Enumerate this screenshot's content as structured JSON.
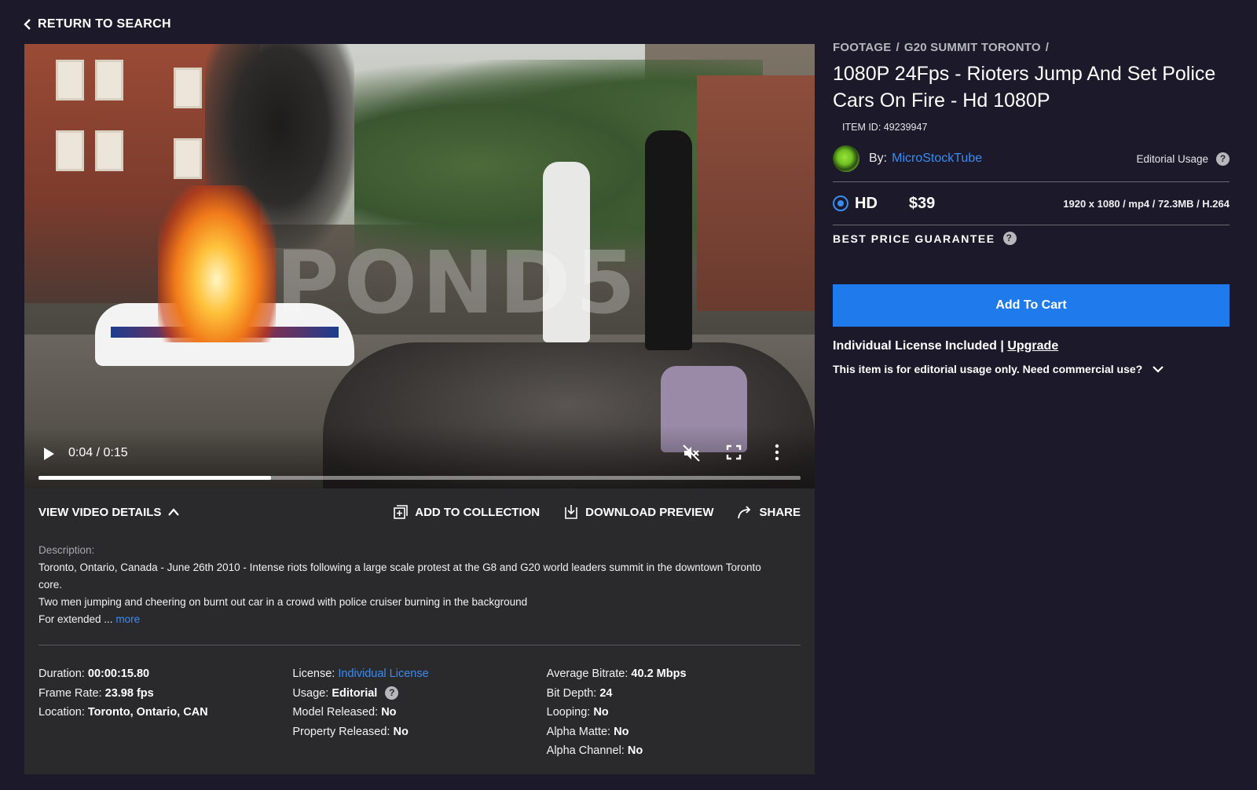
{
  "nav": {
    "back_label": "RETURN TO SEARCH"
  },
  "player": {
    "watermark": "POND5",
    "time_display": "0:04 / 0:15",
    "progress_fraction": 0.305
  },
  "details_bar": {
    "view_details": "VIEW VIDEO DETAILS",
    "add_to_collection": "ADD TO COLLECTION",
    "download_preview": "DOWNLOAD PREVIEW",
    "share": "SHARE"
  },
  "description": {
    "label": "Description:",
    "line1": "Toronto, Ontario, Canada - June 26th 2010 - Intense riots following a large scale protest at the G8 and G20 world leaders summit in the downtown Toronto core.",
    "line2": "Two men jumping and cheering on burnt out car in a crowd with police cruiser burning in the background",
    "line3": "For extended ...",
    "more": "more"
  },
  "meta": {
    "col1": [
      {
        "label": "Duration:",
        "value": "00:00:15.80"
      },
      {
        "label": "Frame Rate:",
        "value": "23.98 fps"
      },
      {
        "label": "Location:",
        "value": "Toronto, Ontario, CAN"
      }
    ],
    "col2": [
      {
        "label": "License:",
        "value": "Individual License"
      },
      {
        "label": "Usage:",
        "value": "Editorial"
      },
      {
        "label": "Model Released:",
        "value": "No"
      },
      {
        "label": "Property Released:",
        "value": "No"
      }
    ],
    "col3": [
      {
        "label": "Average Bitrate:",
        "value": "40.2 Mbps"
      },
      {
        "label": "Bit Depth:",
        "value": "24"
      },
      {
        "label": "Looping:",
        "value": "No"
      },
      {
        "label": "Alpha Matte:",
        "value": "No"
      },
      {
        "label": "Alpha Channel:",
        "value": "No"
      }
    ]
  },
  "item": {
    "breadcrumb": [
      "FOOTAGE",
      "G20 SUMMIT TORONTO"
    ],
    "breadcrumb_sep": "/",
    "title": "1080P 24Fps - Rioters Jump And Set Police Cars On Fire - Hd 1080P",
    "item_id": "ITEM ID: 49239947",
    "by_label": "By:",
    "author": "MicroStockTube",
    "usage_label": "Editorial Usage",
    "help_glyph": "?",
    "format": "HD",
    "price": "$39",
    "spec": "1920 x 1080 / mp4 / 72.3MB / H.264",
    "best_price": "BEST PRICE GUARANTEE",
    "add_to_cart": "Add To Cart",
    "license_included": "Individual License Included",
    "license_sep": "|",
    "upgrade": "Upgrade",
    "editorial_note": "This item is for editorial usage only. Need commercial use?"
  },
  "colors": {
    "background": "#1c1a2a",
    "panel": "#2a2a2d",
    "accent_blue": "#1f7aeb",
    "link_blue": "#3b8cf0"
  },
  "icons": [
    "chevron-left-icon",
    "play-icon",
    "mute-icon",
    "fullscreen-icon",
    "more-vertical-icon",
    "chevron-up-icon",
    "add-collection-icon",
    "download-icon",
    "share-icon",
    "help-icon",
    "chevron-down-icon"
  ]
}
